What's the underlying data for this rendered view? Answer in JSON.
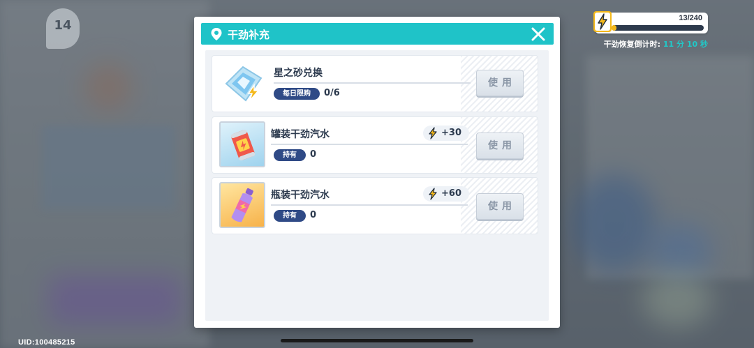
{
  "background": {
    "level": "14",
    "uid": "UID:100485215"
  },
  "energy": {
    "current": 13,
    "max": 240,
    "count_label": "13/240",
    "fraction": 0.054,
    "countdown_label": "干劲恢复倒计时:",
    "countdown_value": "11 分 10 秒"
  },
  "dialog": {
    "title": "干劲补充",
    "close_icon": "close-x-icon",
    "items": [
      {
        "name": "星之砂兑换",
        "tag": "每日限购",
        "value": "0/6",
        "bonus": "",
        "button": "使用",
        "icon": "star-sand-crystal-icon"
      },
      {
        "name": "罐装干劲汽水",
        "tag": "持有",
        "value": "0",
        "bonus": "+30",
        "button": "使用",
        "icon": "energy-can-icon"
      },
      {
        "name": "瓶装干劲汽水",
        "tag": "持有",
        "value": "0",
        "bonus": "+60",
        "button": "使用",
        "icon": "energy-bottle-icon"
      }
    ]
  },
  "colors": {
    "accent": "#1fc3c8",
    "pill": "#2f4a86",
    "bolt": "#f4b81a"
  }
}
